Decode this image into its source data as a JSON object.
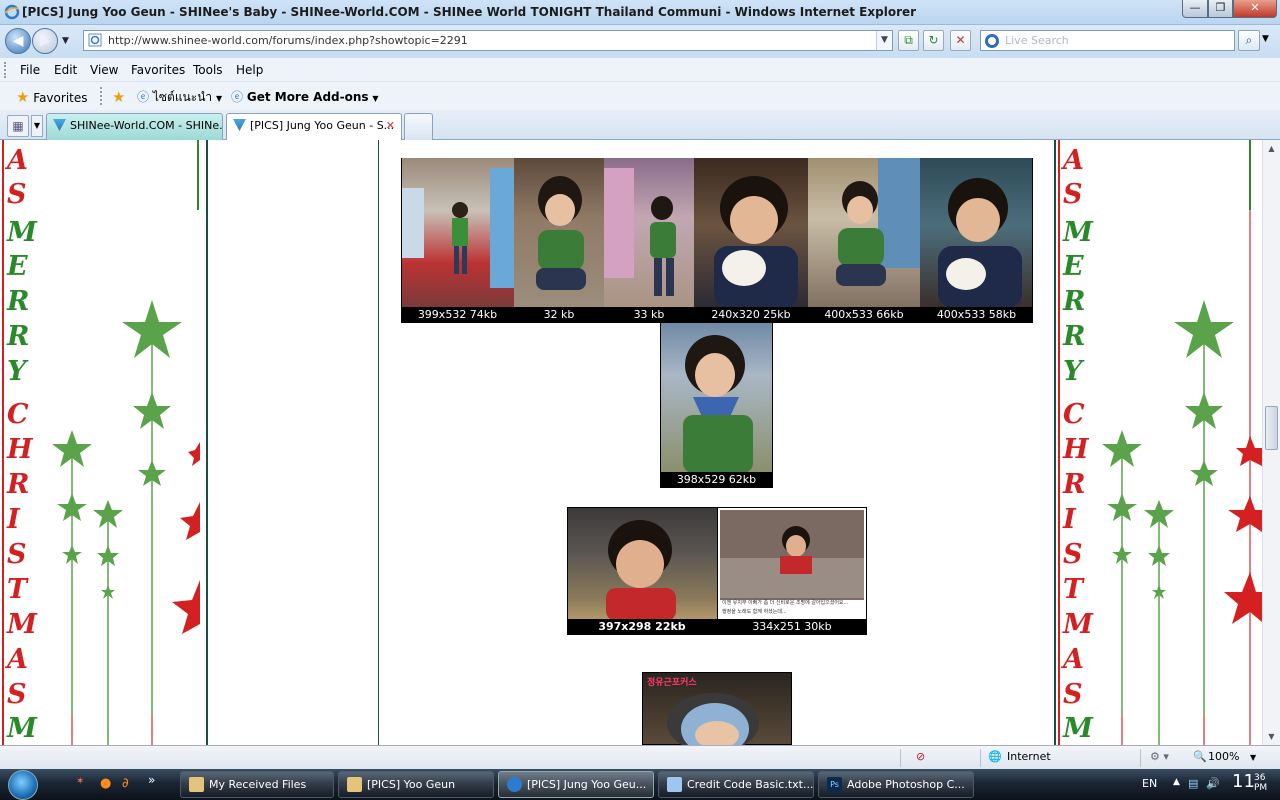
{
  "window": {
    "title": "[PICS] Jung Yoo Geun - SHINee's Baby - SHINee-World.COM - SHINee World TONIGHT Thailand Communi - Windows Internet Explorer",
    "minimize": "—",
    "maximize": "❐",
    "close": "✕"
  },
  "address": {
    "url": "http://www.shinee-world.com/forums/index.php?showtopic=2291",
    "search_placeholder": "Live Search"
  },
  "menu": {
    "items": [
      "File",
      "Edit",
      "View",
      "Favorites",
      "Tools",
      "Help"
    ]
  },
  "favorites": {
    "favorites_label": "Favorites",
    "suggested_sites": "ไซต์แนะนำ",
    "addons": "Get More Add-ons"
  },
  "tabs": [
    {
      "label": "SHINee-World.COM - SHINe...",
      "active": false
    },
    {
      "label": "[PICS] Jung Yoo Geun - S...",
      "active": true
    }
  ],
  "page": {
    "decor_letters": [
      "A",
      "S",
      "M",
      "E",
      "R",
      "R",
      "Y",
      "C",
      "H",
      "R",
      "I",
      "S",
      "T",
      "M",
      "A",
      "S",
      "M"
    ],
    "row1_captions": [
      "399x532 74kb",
      "32 kb",
      "33 kb",
      "240x320 25kb",
      "400x533 66kb",
      "400x533 58kb"
    ],
    "row2_caption": "398x529 62kb",
    "row3_captions": [
      "397x298 22kb",
      "334x251 30kb"
    ],
    "photo_banner": "정유근포커스",
    "photo_note_line1": "이젠 유치부 아빠가 좀 더 신비로운 조명에 갈아입으셨어요...",
    "photo_note_line2": "행정을 노래도 함께 하셨는데..."
  },
  "status": {
    "zone": "Internet",
    "zoom": "100%"
  },
  "taskbar": {
    "buttons": [
      "My Received Files",
      "[PICS] Yoo Geun",
      "[PICS] Jung Yoo Geu...",
      "Credit Code Basic.txt...",
      "Adobe Photoshop C..."
    ],
    "active_index": 2,
    "language": "EN",
    "time_hour": "11",
    "time_minute": "36",
    "time_period": "PM",
    "quick_more": "»"
  }
}
